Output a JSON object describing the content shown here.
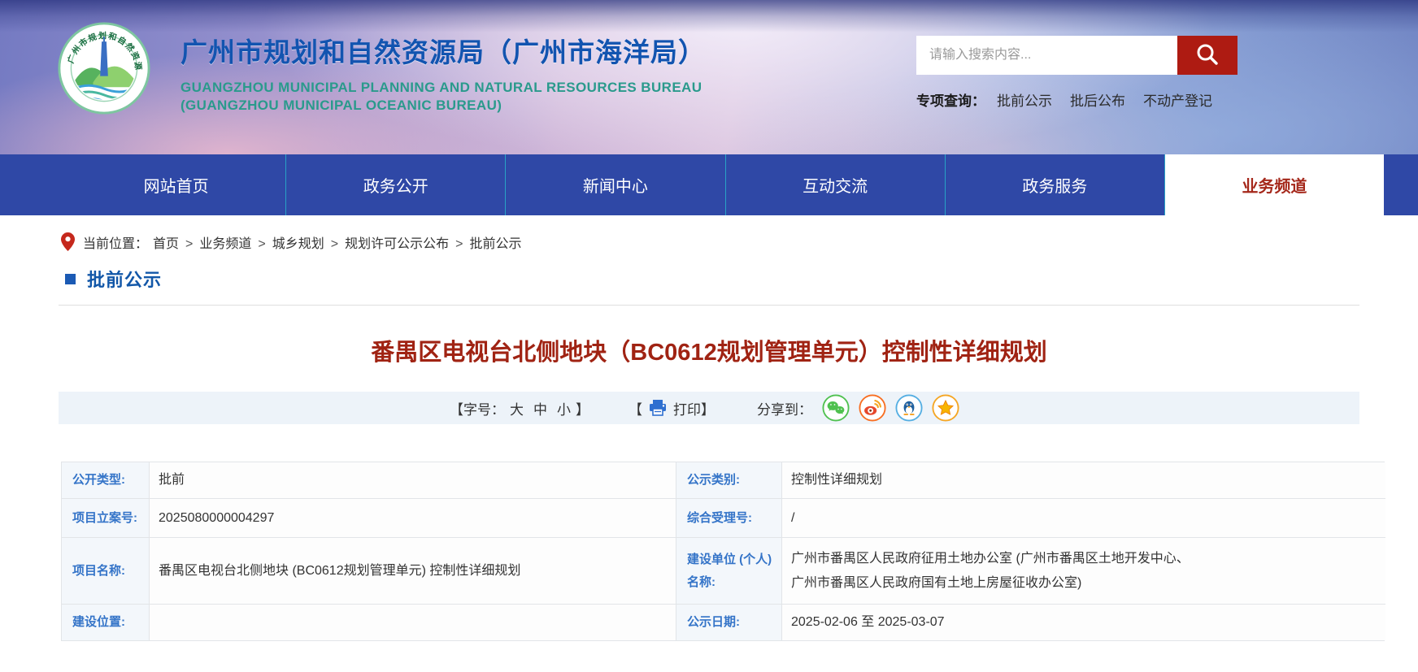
{
  "colors": {
    "nav_blue": "#2F48A6",
    "separator_cyan": "#28A3C6",
    "active_tab_red": "#A5281B",
    "article_title_red": "#A02313",
    "section_heading_blue": "#1257A8",
    "table_label_blue": "#3474C8",
    "search_button_red": "#AE1B12",
    "site_title_blue": "#1254B0",
    "site_subtitle_teal": "#2A9A8C",
    "toolbar_band_bg": "#EDF3F9",
    "table_label_bg": "#F3F7FB",
    "table_border": "#E2E5E8"
  },
  "header": {
    "logo_icon": "bureau-round-emblem",
    "logo_ring_text": "广州市规划和自然资源局",
    "site_title": "广州市规划和自然资源局（广州市海洋局）",
    "site_subtitle_en_1": "GUANGZHOU MUNICIPAL PLANNING AND NATURAL RESOURCES BUREAU",
    "site_subtitle_en_2": "(GUANGZHOU MUNICIPAL OCEANIC BUREAU)",
    "search": {
      "placeholder": "请输入搜索内容...",
      "value": "",
      "button_icon": "search-icon"
    },
    "quick_search": {
      "label": "专项查询：",
      "links": [
        "批前公示",
        "批后公布",
        "不动产登记"
      ]
    }
  },
  "nav": {
    "items": [
      {
        "label": "网站首页",
        "active": false
      },
      {
        "label": "政务公开",
        "active": false
      },
      {
        "label": "新闻中心",
        "active": false
      },
      {
        "label": "互动交流",
        "active": false
      },
      {
        "label": "政务服务",
        "active": false
      },
      {
        "label": "业务频道",
        "active": true
      }
    ]
  },
  "breadcrumb": {
    "pin_icon": "location-pin-icon",
    "label": "当前位置：",
    "items": [
      "首页",
      "业务频道",
      "城乡规划",
      "规划许可公示公布",
      "批前公示"
    ],
    "separator": ">"
  },
  "section": {
    "title": "批前公示"
  },
  "article": {
    "title": "番禺区电视台北侧地块（BC0612规划管理单元）控制性详细规划",
    "toolbar": {
      "font_prefix": "【字号：",
      "font_sizes": [
        "大",
        "中",
        "小"
      ],
      "font_suffix": "】",
      "print_open": "【",
      "print_icon": "printer-icon",
      "print_label": "打印",
      "print_close": "】",
      "share_label": "分享到：",
      "share_icons": [
        "wechat-icon",
        "weibo-icon",
        "qq-icon",
        "favorite-star-icon"
      ]
    }
  },
  "detail_table": {
    "rows": [
      {
        "left_label": "公开类型:",
        "left_value": "批前",
        "right_label": "公示类别:",
        "right_value": "控制性详细规划"
      },
      {
        "left_label": "项目立案号:",
        "left_value": "2025080000004297",
        "right_label": "综合受理号:",
        "right_value": "/"
      },
      {
        "left_label": "项目名称:",
        "left_value": "番禺区电视台北侧地块 (BC0612规划管理单元) 控制性详细规划",
        "right_label": "建设单位 (个人)\n名称:",
        "right_value": "广州市番禺区人民政府征用土地办公室 (广州市番禺区土地开发中心、\n广州市番禺区人民政府国有土地上房屋征收办公室)"
      },
      {
        "left_label": "建设位置:",
        "left_value": "",
        "right_label": "公示日期:",
        "right_value": "2025-02-06 至 2025-03-07"
      }
    ]
  }
}
